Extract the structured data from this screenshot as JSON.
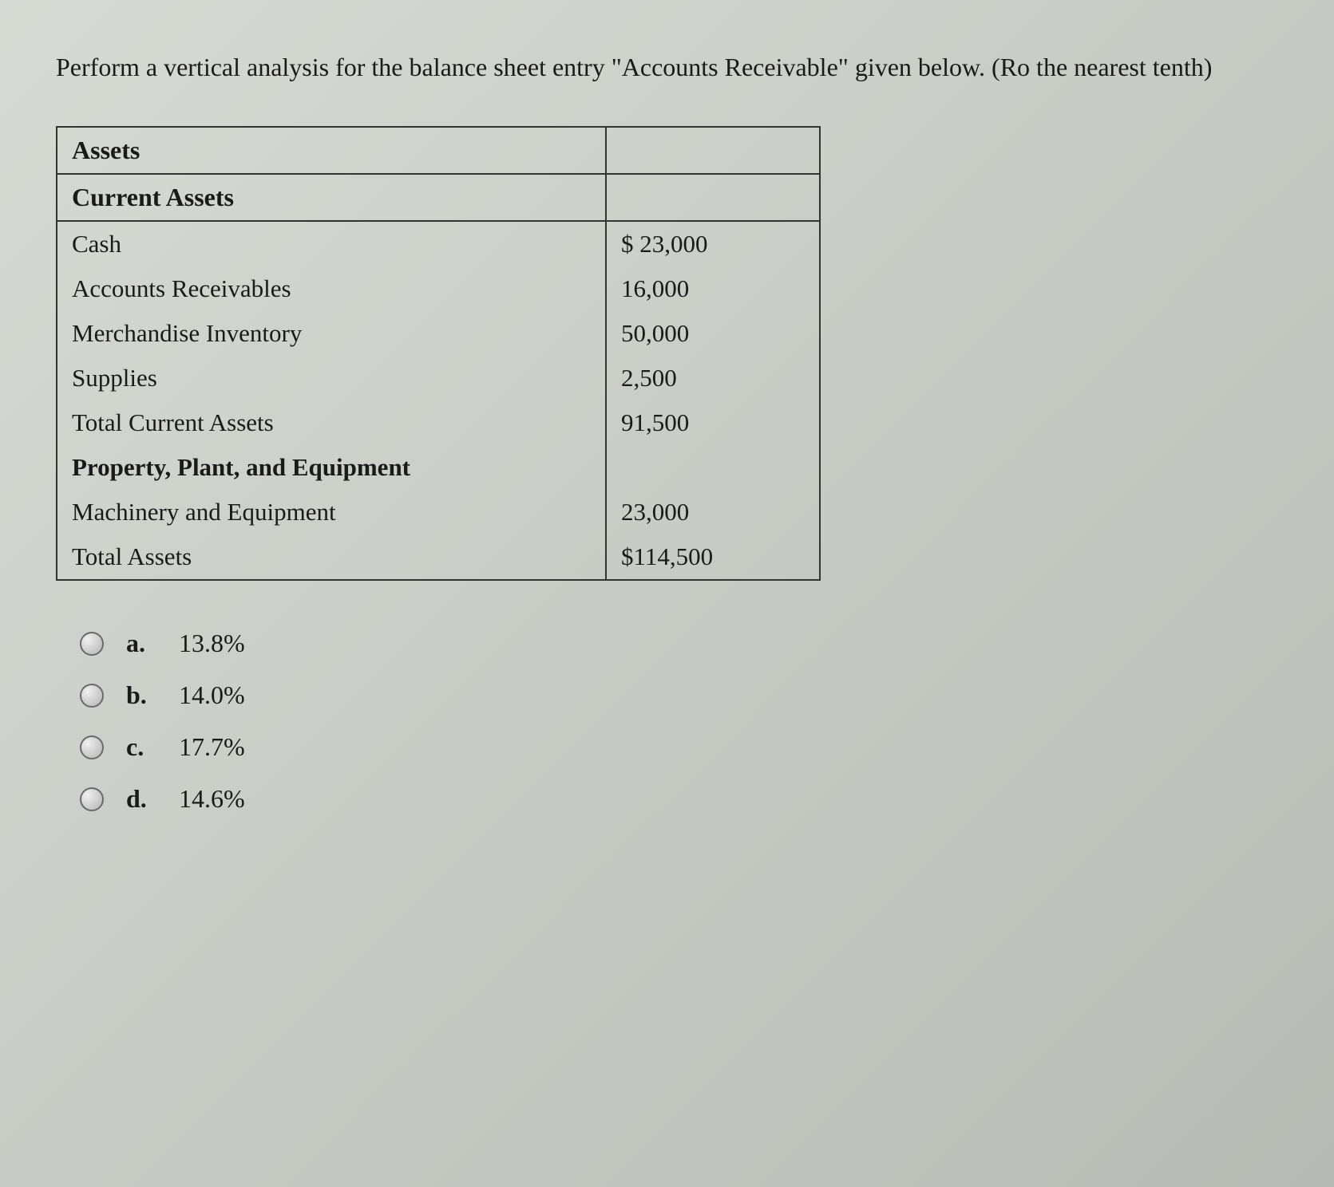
{
  "question": "Perform a vertical analysis for the balance sheet entry \"Accounts Receivable\" given below. (Ro the nearest tenth)",
  "table": {
    "header1": "Assets",
    "section1": "Current Assets",
    "rows": [
      {
        "label": "Cash",
        "value": "$ 23,000"
      },
      {
        "label": "Accounts Receivables",
        "value": "16,000"
      },
      {
        "label": "Merchandise Inventory",
        "value": "50,000"
      },
      {
        "label": "Supplies",
        "value": "2,500"
      },
      {
        "label": "Total Current Assets",
        "value": "91,500"
      }
    ],
    "section2": "Property, Plant, and Equipment",
    "rows2": [
      {
        "label": "Machinery and Equipment",
        "value": "23,000"
      },
      {
        "label": "Total Assets",
        "value": "$114,500"
      }
    ]
  },
  "options": [
    {
      "letter": "a.",
      "text": "13.8%"
    },
    {
      "letter": "b.",
      "text": "14.0%"
    },
    {
      "letter": "c.",
      "text": "17.7%"
    },
    {
      "letter": "d.",
      "text": "14.6%"
    }
  ]
}
